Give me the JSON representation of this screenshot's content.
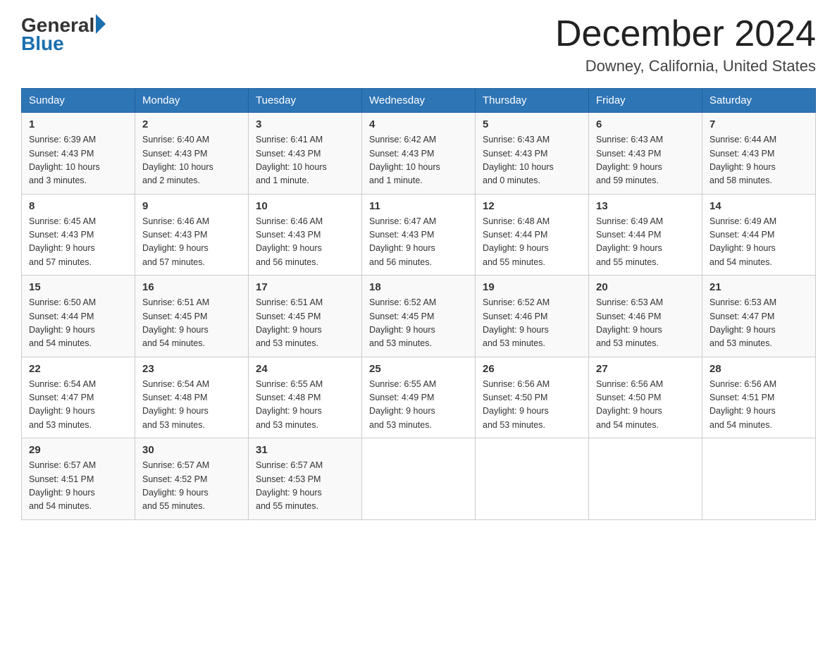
{
  "header": {
    "logo_general": "General",
    "logo_blue": "Blue",
    "title": "December 2024",
    "subtitle": "Downey, California, United States"
  },
  "weekdays": [
    "Sunday",
    "Monday",
    "Tuesday",
    "Wednesday",
    "Thursday",
    "Friday",
    "Saturday"
  ],
  "weeks": [
    [
      {
        "day": "1",
        "sunrise": "6:39 AM",
        "sunset": "4:43 PM",
        "daylight": "10 hours and 3 minutes."
      },
      {
        "day": "2",
        "sunrise": "6:40 AM",
        "sunset": "4:43 PM",
        "daylight": "10 hours and 2 minutes."
      },
      {
        "day": "3",
        "sunrise": "6:41 AM",
        "sunset": "4:43 PM",
        "daylight": "10 hours and 1 minute."
      },
      {
        "day": "4",
        "sunrise": "6:42 AM",
        "sunset": "4:43 PM",
        "daylight": "10 hours and 1 minute."
      },
      {
        "day": "5",
        "sunrise": "6:43 AM",
        "sunset": "4:43 PM",
        "daylight": "10 hours and 0 minutes."
      },
      {
        "day": "6",
        "sunrise": "6:43 AM",
        "sunset": "4:43 PM",
        "daylight": "9 hours and 59 minutes."
      },
      {
        "day": "7",
        "sunrise": "6:44 AM",
        "sunset": "4:43 PM",
        "daylight": "9 hours and 58 minutes."
      }
    ],
    [
      {
        "day": "8",
        "sunrise": "6:45 AM",
        "sunset": "4:43 PM",
        "daylight": "9 hours and 57 minutes."
      },
      {
        "day": "9",
        "sunrise": "6:46 AM",
        "sunset": "4:43 PM",
        "daylight": "9 hours and 57 minutes."
      },
      {
        "day": "10",
        "sunrise": "6:46 AM",
        "sunset": "4:43 PM",
        "daylight": "9 hours and 56 minutes."
      },
      {
        "day": "11",
        "sunrise": "6:47 AM",
        "sunset": "4:43 PM",
        "daylight": "9 hours and 56 minutes."
      },
      {
        "day": "12",
        "sunrise": "6:48 AM",
        "sunset": "4:44 PM",
        "daylight": "9 hours and 55 minutes."
      },
      {
        "day": "13",
        "sunrise": "6:49 AM",
        "sunset": "4:44 PM",
        "daylight": "9 hours and 55 minutes."
      },
      {
        "day": "14",
        "sunrise": "6:49 AM",
        "sunset": "4:44 PM",
        "daylight": "9 hours and 54 minutes."
      }
    ],
    [
      {
        "day": "15",
        "sunrise": "6:50 AM",
        "sunset": "4:44 PM",
        "daylight": "9 hours and 54 minutes."
      },
      {
        "day": "16",
        "sunrise": "6:51 AM",
        "sunset": "4:45 PM",
        "daylight": "9 hours and 54 minutes."
      },
      {
        "day": "17",
        "sunrise": "6:51 AM",
        "sunset": "4:45 PM",
        "daylight": "9 hours and 53 minutes."
      },
      {
        "day": "18",
        "sunrise": "6:52 AM",
        "sunset": "4:45 PM",
        "daylight": "9 hours and 53 minutes."
      },
      {
        "day": "19",
        "sunrise": "6:52 AM",
        "sunset": "4:46 PM",
        "daylight": "9 hours and 53 minutes."
      },
      {
        "day": "20",
        "sunrise": "6:53 AM",
        "sunset": "4:46 PM",
        "daylight": "9 hours and 53 minutes."
      },
      {
        "day": "21",
        "sunrise": "6:53 AM",
        "sunset": "4:47 PM",
        "daylight": "9 hours and 53 minutes."
      }
    ],
    [
      {
        "day": "22",
        "sunrise": "6:54 AM",
        "sunset": "4:47 PM",
        "daylight": "9 hours and 53 minutes."
      },
      {
        "day": "23",
        "sunrise": "6:54 AM",
        "sunset": "4:48 PM",
        "daylight": "9 hours and 53 minutes."
      },
      {
        "day": "24",
        "sunrise": "6:55 AM",
        "sunset": "4:48 PM",
        "daylight": "9 hours and 53 minutes."
      },
      {
        "day": "25",
        "sunrise": "6:55 AM",
        "sunset": "4:49 PM",
        "daylight": "9 hours and 53 minutes."
      },
      {
        "day": "26",
        "sunrise": "6:56 AM",
        "sunset": "4:50 PM",
        "daylight": "9 hours and 53 minutes."
      },
      {
        "day": "27",
        "sunrise": "6:56 AM",
        "sunset": "4:50 PM",
        "daylight": "9 hours and 54 minutes."
      },
      {
        "day": "28",
        "sunrise": "6:56 AM",
        "sunset": "4:51 PM",
        "daylight": "9 hours and 54 minutes."
      }
    ],
    [
      {
        "day": "29",
        "sunrise": "6:57 AM",
        "sunset": "4:51 PM",
        "daylight": "9 hours and 54 minutes."
      },
      {
        "day": "30",
        "sunrise": "6:57 AM",
        "sunset": "4:52 PM",
        "daylight": "9 hours and 55 minutes."
      },
      {
        "day": "31",
        "sunrise": "6:57 AM",
        "sunset": "4:53 PM",
        "daylight": "9 hours and 55 minutes."
      },
      null,
      null,
      null,
      null
    ]
  ],
  "labels": {
    "sunrise": "Sunrise:",
    "sunset": "Sunset:",
    "daylight": "Daylight:"
  }
}
